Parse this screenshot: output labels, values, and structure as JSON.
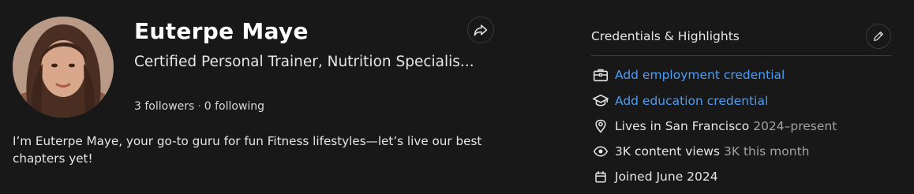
{
  "profile": {
    "name": "Euterpe Maye",
    "tagline": "Certified Personal Trainer, Nutrition Specialis...",
    "followers": "3 followers",
    "separator": "·",
    "following": "0 following",
    "bio": "I’m Euterpe Maye, your go-to guru for fun Fitness lifestyles—let’s live our best chapters yet!"
  },
  "credentials": {
    "title": "Credentials & Highlights",
    "items": [
      {
        "icon": "briefcase-icon",
        "label": "Add employment credential",
        "sub": ""
      },
      {
        "icon": "graduation-cap-icon",
        "label": "Add education credential",
        "sub": ""
      },
      {
        "icon": "location-pin-icon",
        "label": "Lives in San Francisco",
        "sub": "2024–present"
      },
      {
        "icon": "eye-icon",
        "label": "3K content views",
        "sub": "3K this month"
      },
      {
        "icon": "calendar-icon",
        "label": "Joined June 2024",
        "sub": ""
      }
    ]
  },
  "colors": {
    "background": "#181818",
    "link": "#4e9cf5",
    "muted": "#a0a3a6"
  }
}
